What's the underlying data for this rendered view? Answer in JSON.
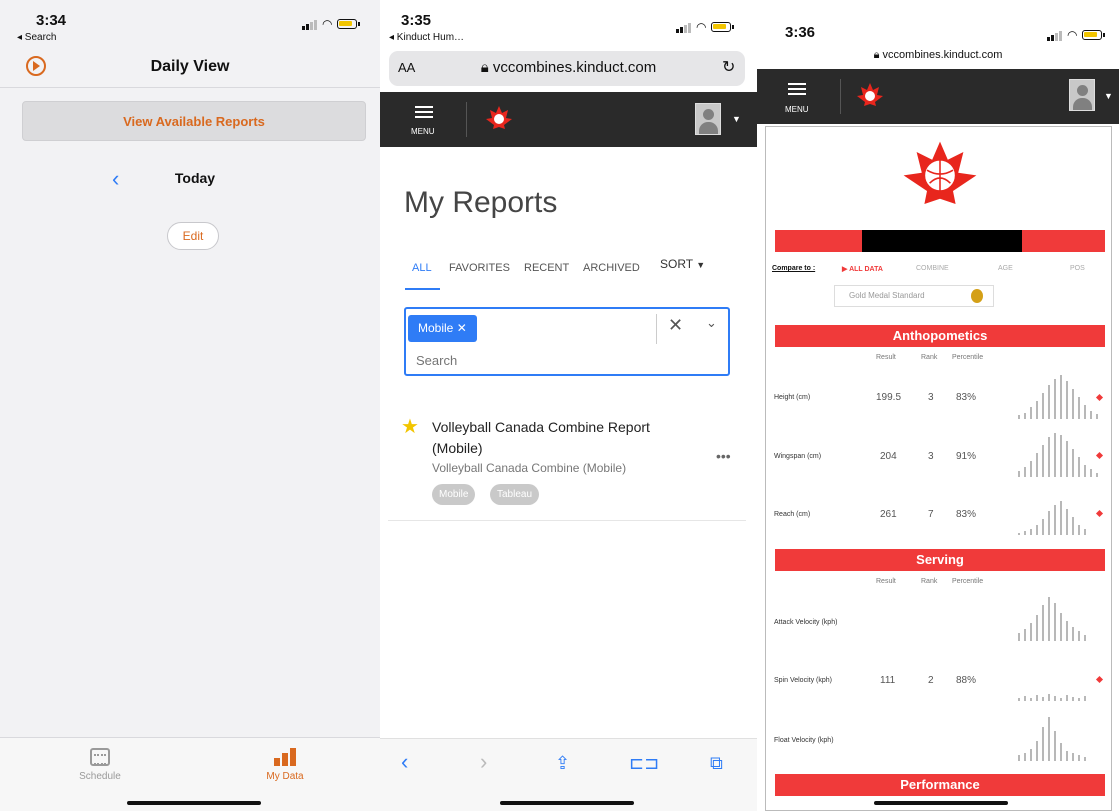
{
  "screen1": {
    "status": {
      "time": "3:34",
      "back": "◂ Search"
    },
    "header": {
      "title": "Daily View"
    },
    "reports_button": "View Available Reports",
    "date_label": "Today",
    "edit_button": "Edit",
    "tabs": [
      {
        "label": "Schedule",
        "icon": "calendar-icon",
        "active": false
      },
      {
        "label": "My Data",
        "icon": "bar-chart-icon",
        "active": true
      }
    ],
    "accent": "#d9691f"
  },
  "screen2": {
    "status": {
      "time": "3:35",
      "back": "◂ Kinduct Hum…"
    },
    "address_bar": {
      "text_size": "AA",
      "url": "vccombines.kinduct.com"
    },
    "nav": {
      "menu_label": "MENU"
    },
    "page_title": "My Reports",
    "filter_tabs": [
      "ALL",
      "FAVORITES",
      "RECENT",
      "ARCHIVED"
    ],
    "active_tab": "ALL",
    "sort_label": "SORT",
    "filter": {
      "chip": "Mobile",
      "placeholder": "Search"
    },
    "report": {
      "title": "Volleyball Canada Combine Report (Mobile)",
      "subtitle": "Volleyball Canada Combine (Mobile)",
      "tags": [
        "Mobile",
        "Tableau"
      ],
      "favorite": true
    },
    "accent": "#2f7cf6"
  },
  "screen3": {
    "status": {
      "time": "3:36"
    },
    "url": "vccombines.kinduct.com",
    "nav": {
      "menu_label": "MENU"
    },
    "compare_label": "Compare to :",
    "compare_options": [
      "▶ ALL DATA",
      "COMBINE",
      "AGE",
      "POS"
    ],
    "standard": "Gold Medal Standard",
    "columns": [
      "Result",
      "Rank",
      "Percentile"
    ],
    "sections": [
      {
        "title": "Anthopometics",
        "rows": [
          {
            "label": "Height (cm)",
            "result": "199.5",
            "rank": "3",
            "percentile": "83%"
          },
          {
            "label": "Wingspan (cm)",
            "result": "204",
            "rank": "3",
            "percentile": "91%"
          },
          {
            "label": "Reach (cm)",
            "result": "261",
            "rank": "7",
            "percentile": "83%"
          }
        ]
      },
      {
        "title": "Serving",
        "rows": [
          {
            "label": "Attack Velocity (kph)",
            "result": "",
            "rank": "",
            "percentile": ""
          },
          {
            "label": "Spin Velocity (kph)",
            "result": "111",
            "rank": "2",
            "percentile": "88%"
          },
          {
            "label": "Float Velocity (kph)",
            "result": "",
            "rank": "",
            "percentile": ""
          }
        ]
      },
      {
        "title": "Performance",
        "rows": []
      }
    ],
    "brand_red": "#f03a3a"
  }
}
